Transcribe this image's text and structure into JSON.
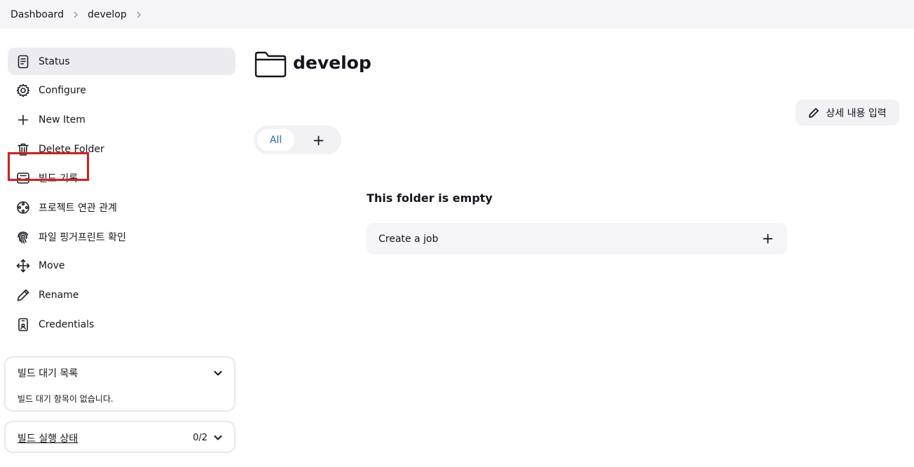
{
  "breadcrumb": [
    {
      "label": "Dashboard"
    },
    {
      "label": "develop"
    }
  ],
  "sidebar": {
    "items": [
      {
        "label": "Status",
        "icon": "document-icon",
        "active": true
      },
      {
        "label": "Configure",
        "icon": "gear-icon"
      },
      {
        "label": "New Item",
        "icon": "plus-icon",
        "highlighted": true
      },
      {
        "label": "Delete Folder",
        "icon": "trash-icon"
      },
      {
        "label": "빌드 기록",
        "icon": "inbox-icon"
      },
      {
        "label": "프로젝트 연관 관계",
        "icon": "relationship-icon"
      },
      {
        "label": "파일 핑거프린트 확인",
        "icon": "fingerprint-icon"
      },
      {
        "label": "Move",
        "icon": "move-icon"
      },
      {
        "label": "Rename",
        "icon": "pencil-icon"
      },
      {
        "label": "Credentials",
        "icon": "credentials-icon"
      }
    ],
    "highlight_color": "#e01b1b"
  },
  "build_queue": {
    "title": "빌드 대기 목록",
    "empty_text": "빌드 대기 항목이 없습니다."
  },
  "executors": {
    "title": "빌드 실행 상태",
    "count": "0/2"
  },
  "main": {
    "title": "develop",
    "description_button": "상세 내용 입력",
    "tabs": [
      {
        "label": "All",
        "active": true
      }
    ],
    "empty_title": "This folder is empty",
    "create_job_label": "Create a job"
  },
  "colors": {
    "accent": "#1c6fc4",
    "topbar_bg": "#f5f5f7",
    "active_bg": "#ebebf0"
  }
}
